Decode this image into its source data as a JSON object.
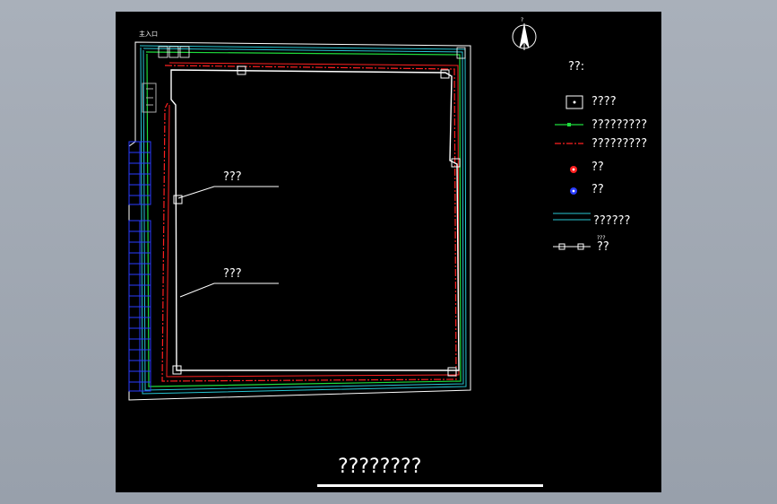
{
  "drawing": {
    "entrance_label": "主入口",
    "north_label": "?",
    "title": "????????",
    "callouts": [
      {
        "label": "???"
      },
      {
        "label": "???"
      }
    ]
  },
  "legend": {
    "heading": "??:",
    "items": [
      {
        "label": "????",
        "icon": "box-symbol-icon"
      },
      {
        "label": "?????????",
        "icon": "green-line-icon",
        "color": "#1edc3c"
      },
      {
        "label": "?????????",
        "icon": "red-dashdot-line-icon",
        "color": "#ff2020"
      },
      {
        "label": "??",
        "icon": "red-circle-icon",
        "color": "#ff2020"
      },
      {
        "label": "??",
        "icon": "blue-circle-icon",
        "color": "#2a3cff"
      },
      {
        "label": "??????",
        "icon": "cyan-double-line-icon",
        "color": "#27c7d4"
      },
      {
        "label": "??",
        "icon": "fence-line-icon",
        "tag": "???"
      }
    ]
  },
  "colors": {
    "background": "#000000",
    "line_white": "#ffffff",
    "line_green": "#1edc3c",
    "line_red": "#ff2020",
    "line_cyan": "#27c7d4",
    "line_blue": "#2a3cff"
  }
}
